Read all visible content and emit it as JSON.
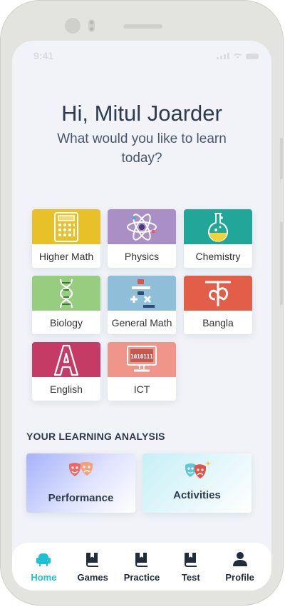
{
  "status": {
    "time": "9:41"
  },
  "greeting": {
    "title": "Hi, Mitul Joarder",
    "subtitle": "What would you like to learn today?"
  },
  "subjects": [
    {
      "label": "Higher Math",
      "color": "#e7c127",
      "icon": "calculator-icon"
    },
    {
      "label": "Physics",
      "color": "#a98fc6",
      "icon": "atom-icon"
    },
    {
      "label": "Chemistry",
      "color": "#22a699",
      "icon": "flask-icon"
    },
    {
      "label": "Biology",
      "color": "#97cd7e",
      "icon": "dna-icon"
    },
    {
      "label": "General Math",
      "color": "#8fbfd8",
      "icon": "math-operators-icon"
    },
    {
      "label": "Bangla",
      "color": "#e35e49",
      "icon": "bangla-letter-icon"
    },
    {
      "label": "English",
      "color": "#c43b66",
      "icon": "letter-a-icon"
    },
    {
      "label": "ICT",
      "color": "#ef9589",
      "icon": "computer-binary-icon",
      "binary_text": "1010111"
    }
  ],
  "analysis": {
    "title": "YOUR LEARNING ANALYSIS",
    "cards": [
      {
        "label": "Performance",
        "icon": "theater-masks-icon"
      },
      {
        "label": "Activities",
        "icon": "theater-masks-sparkle-icon"
      }
    ]
  },
  "nav": {
    "accent": "#19c1d6",
    "items": [
      {
        "label": "Home",
        "icon": "home-chair-icon",
        "active": true
      },
      {
        "label": "Games",
        "icon": "book-icon",
        "active": false
      },
      {
        "label": "Practice",
        "icon": "book-icon",
        "active": false
      },
      {
        "label": "Test",
        "icon": "book-icon",
        "active": false
      },
      {
        "label": "Profile",
        "icon": "person-icon",
        "active": false
      }
    ]
  }
}
